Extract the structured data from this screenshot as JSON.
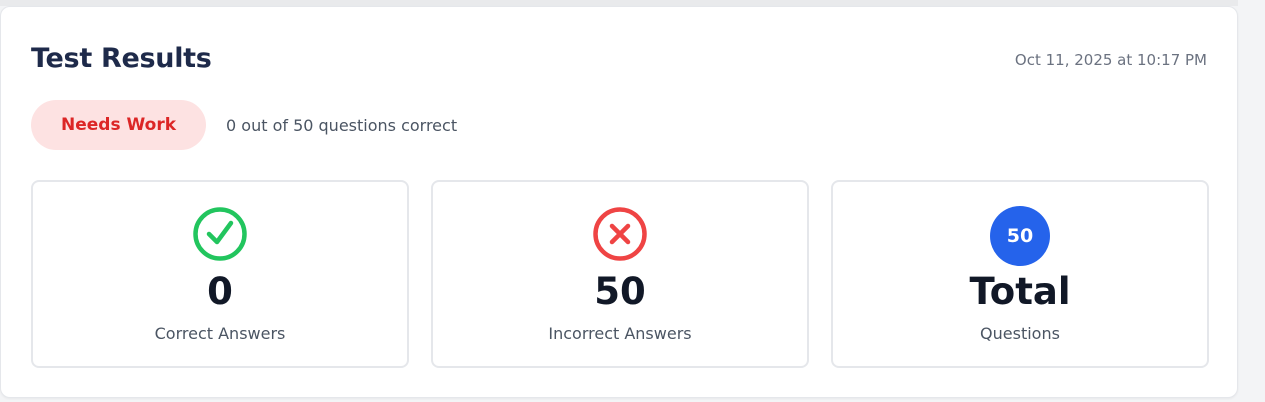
{
  "header": {
    "title": "Test Results",
    "timestamp": "Oct 11, 2025 at 10:17 PM"
  },
  "status": {
    "badge_label": "Needs Work",
    "summary": "0 out of 50 questions correct"
  },
  "stats": [
    {
      "icon": "check-circle-icon",
      "value": "0",
      "label": "Correct Answers",
      "color": "#22c55e"
    },
    {
      "icon": "x-circle-icon",
      "value": "50",
      "label": "Incorrect Answers",
      "color": "#ef4444"
    },
    {
      "icon_text": "50",
      "value": "Total",
      "label": "Questions",
      "color": "#2563eb"
    }
  ],
  "colors": {
    "badge_bg": "#fde2e2",
    "badge_text": "#dc2626",
    "title": "#1e2a4a"
  }
}
